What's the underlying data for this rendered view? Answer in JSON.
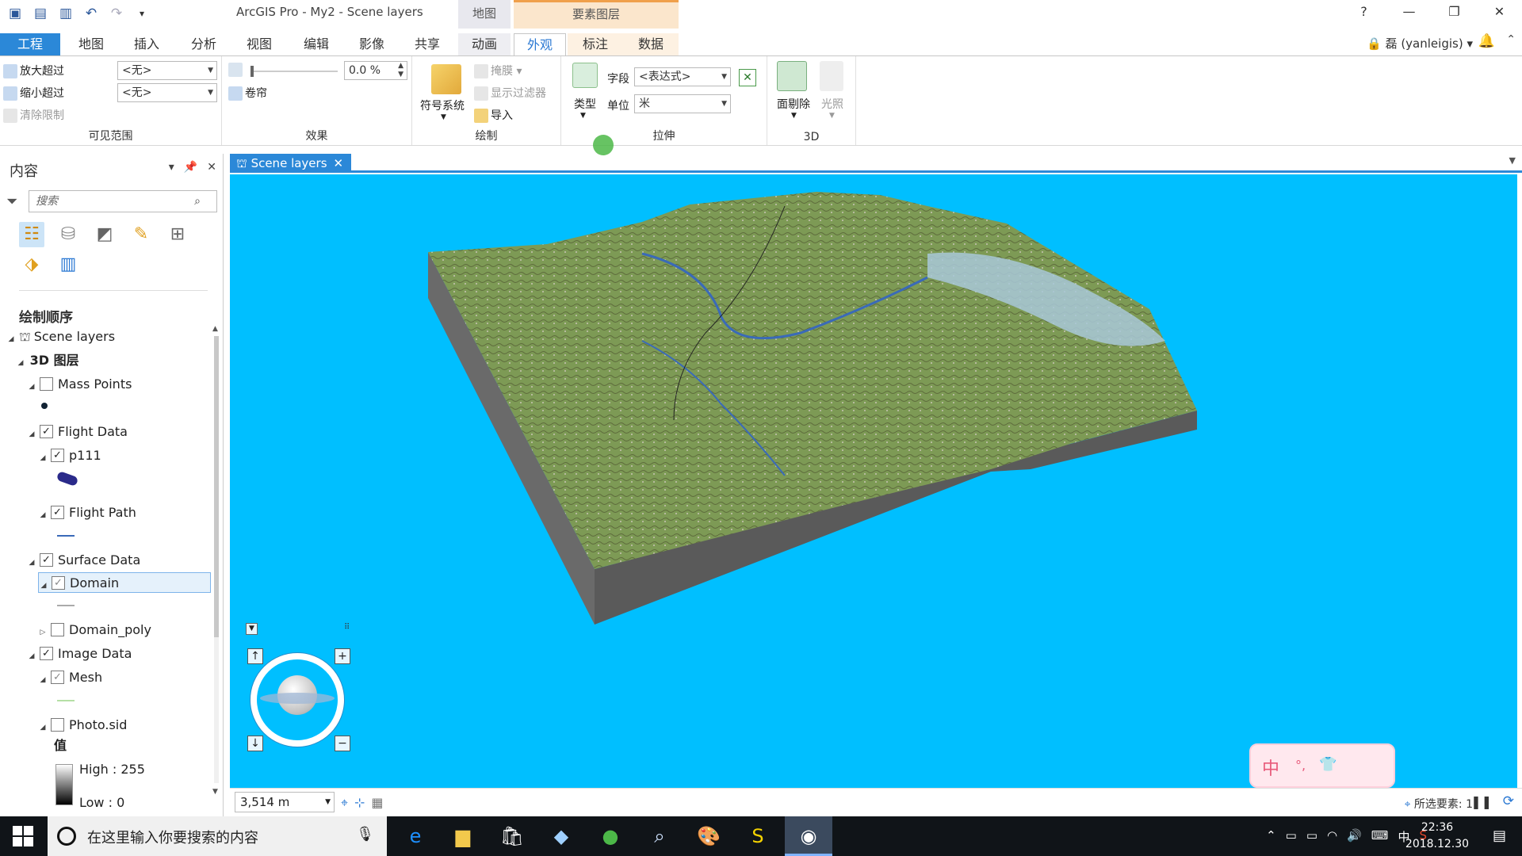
{
  "app": {
    "title": "ArcGIS Pro - My2 - Scene layers",
    "context_map": "地图",
    "context_feature": "要素图层",
    "user": "磊 (yanleigis)",
    "window_controls": [
      "?",
      "—",
      "❐",
      "✕"
    ]
  },
  "tabs": {
    "project": "工程",
    "items": [
      "地图",
      "插入",
      "分析",
      "视图",
      "编辑",
      "影像",
      "共享",
      "动画",
      "外观",
      "标注",
      "数据"
    ],
    "active": "外观"
  },
  "ribbon": {
    "visible_range": {
      "label": "可见范围",
      "zoom_in_beyond": "放大超过",
      "zoom_out_beyond": "缩小超过",
      "clear_limits": "清除限制",
      "zoom_in_value": "<无>",
      "zoom_out_value": "<无>"
    },
    "effects": {
      "label": "效果",
      "transparency": "0.0 %",
      "swipe": "卷帘"
    },
    "drawing": {
      "label": "绘制",
      "symbology": "符号系统",
      "mask": "掩膜",
      "display_filter": "显示过滤器",
      "import": "导入"
    },
    "extrusion": {
      "label": "拉伸",
      "type": "类型",
      "field_label": "字段",
      "field_value": "<表达式>",
      "unit_label": "单位",
      "unit_value": "米"
    },
    "threeD": {
      "label": "3D",
      "face_culling": "面剔除",
      "lighting": "光照"
    }
  },
  "contents": {
    "title": "内容",
    "search_placeholder": "搜索",
    "drawing_order": "绘制顺序",
    "tree": [
      {
        "label": "Scene layers"
      },
      {
        "label": "3D 图层"
      },
      {
        "label": "Mass Points",
        "checked": false
      },
      {
        "label": "Flight Data",
        "checked": true
      },
      {
        "label": "p111",
        "checked": true
      },
      {
        "label": "Flight Path",
        "checked": true
      },
      {
        "label": "Surface Data",
        "checked": true
      },
      {
        "label": "Domain",
        "checked": true
      },
      {
        "label": "Domain_poly",
        "checked": false
      },
      {
        "label": "Image Data",
        "checked": true
      },
      {
        "label": "Mesh",
        "checked": true
      },
      {
        "label": "Photo.sid",
        "checked": false
      }
    ],
    "legend": {
      "value_label": "值",
      "high": "High : 255",
      "low": "Low : 0"
    }
  },
  "map_view": {
    "tab_title": "Scene layers",
    "scale": "3,514 m",
    "selected_features": "所选要素: 1",
    "ime": {
      "lang": "中",
      "punct": "°,",
      "skin": "👕"
    }
  },
  "taskbar": {
    "search_placeholder": "在这里输入你要搜索的内容",
    "ime_indicator": "中",
    "time": "22:36",
    "date": "2018.12.30"
  },
  "colors": {
    "accent": "#2b88d8",
    "scene_sky": "#00bfff",
    "terrain_side": "#5a5a5a",
    "terrain_top": "#7d9a55"
  }
}
